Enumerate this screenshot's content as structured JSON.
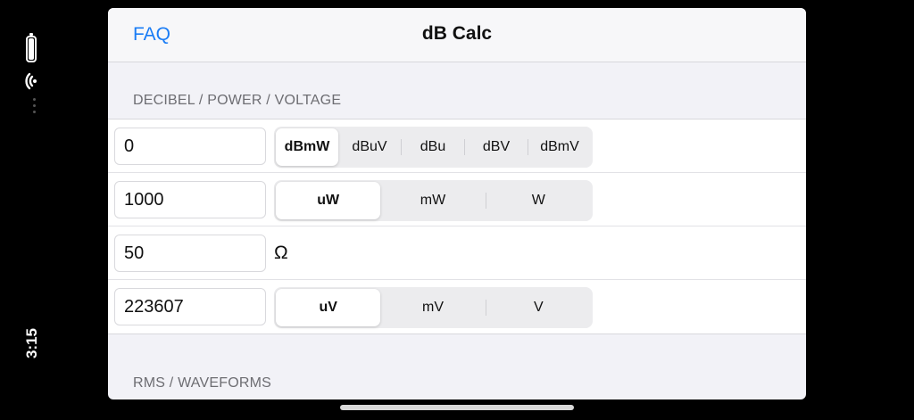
{
  "status": {
    "time": "3:15",
    "icons": [
      "battery-icon",
      "wifi-icon"
    ]
  },
  "navbar": {
    "left_button": "FAQ",
    "title": "dB Calc"
  },
  "sections": [
    {
      "header": "DECIBEL / POWER / VOLTAGE"
    },
    {
      "header": "RMS / WAVEFORMS"
    }
  ],
  "rows": {
    "decibel": {
      "value": "0",
      "units": [
        "dBmW",
        "dBuV",
        "dBu",
        "dBV",
        "dBmV"
      ],
      "selected": "dBmW"
    },
    "power": {
      "value": "1000",
      "units": [
        "uW",
        "mW",
        "W"
      ],
      "selected": "uW"
    },
    "impedance": {
      "value": "50",
      "unit": "Ω"
    },
    "voltage": {
      "value": "223607",
      "units": [
        "uV",
        "mV",
        "V"
      ],
      "selected": "uV"
    }
  },
  "colors": {
    "accent": "#1a7cf5",
    "background": "#f2f2f7",
    "cell": "#ffffff"
  }
}
